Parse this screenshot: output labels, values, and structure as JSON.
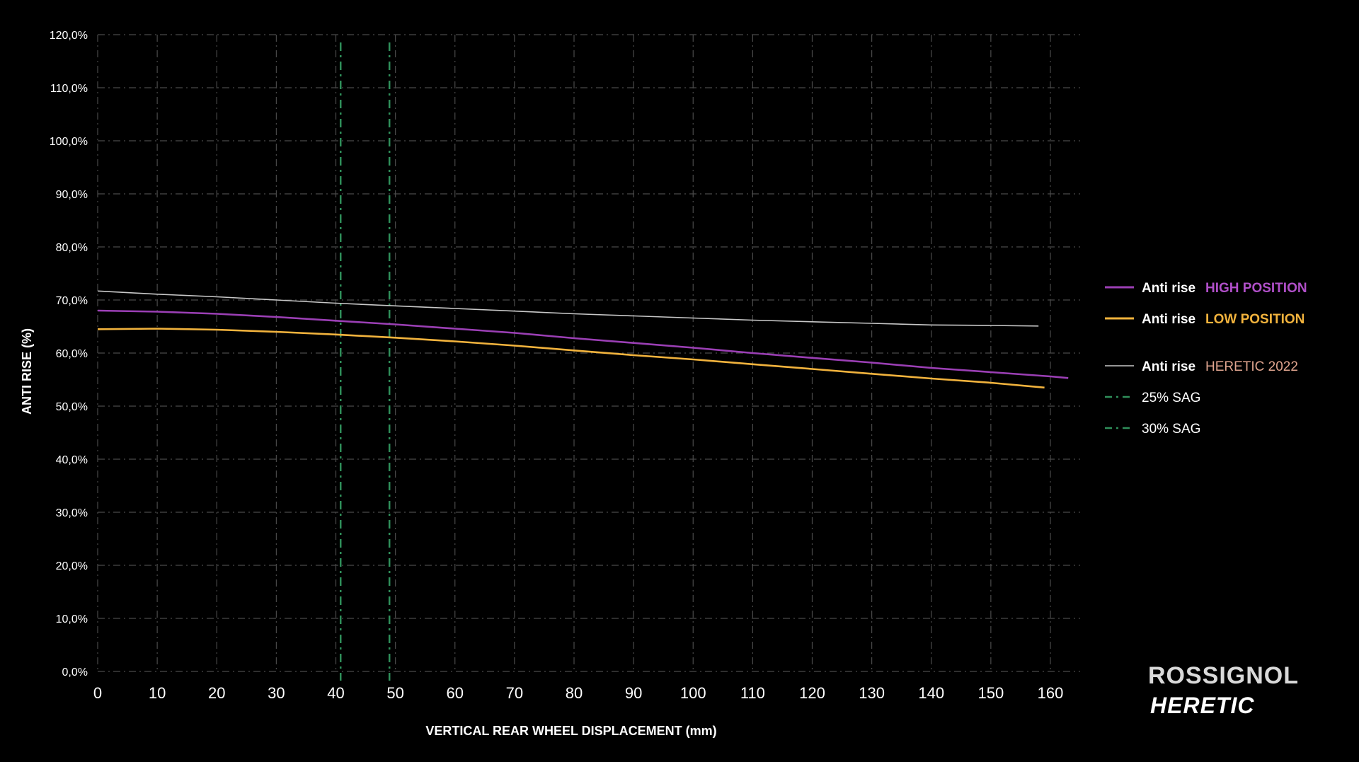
{
  "chart_data": {
    "type": "line",
    "xlabel": "VERTICAL REAR WHEEL DISPLACEMENT (mm)",
    "ylabel": "ANTI RISE (%)",
    "xlim": [
      0,
      165
    ],
    "ylim": [
      0,
      120
    ],
    "x_ticks": [
      "0",
      "10",
      "20",
      "30",
      "40",
      "50",
      "60",
      "70",
      "80",
      "90",
      "100",
      "110",
      "120",
      "130",
      "140",
      "150",
      "160"
    ],
    "y_ticks": [
      "0,0%",
      "10,0%",
      "20,0%",
      "30,0%",
      "40,0%",
      "50,0%",
      "60,0%",
      "70,0%",
      "80,0%",
      "90,0%",
      "100,0%",
      "110,0%",
      "120,0%"
    ],
    "grid": true,
    "legend_position": "right",
    "series": [
      {
        "key": "high",
        "label_bold": "Anti rise",
        "label_tag": "HIGH POSITION",
        "color": "#9b3fb5",
        "tag_color": "#b04fc8",
        "style": "solid",
        "points": [
          [
            0,
            68.0
          ],
          [
            10,
            67.8
          ],
          [
            20,
            67.4
          ],
          [
            30,
            66.8
          ],
          [
            40,
            66.1
          ],
          [
            50,
            65.4
          ],
          [
            60,
            64.6
          ],
          [
            70,
            63.8
          ],
          [
            80,
            62.8
          ],
          [
            90,
            61.9
          ],
          [
            100,
            61.0
          ],
          [
            110,
            60.0
          ],
          [
            120,
            59.1
          ],
          [
            130,
            58.2
          ],
          [
            140,
            57.2
          ],
          [
            150,
            56.4
          ],
          [
            160,
            55.6
          ],
          [
            163,
            55.3
          ]
        ]
      },
      {
        "key": "low",
        "label_bold": "Anti rise",
        "label_tag": "LOW POSITION",
        "color": "#f2b33d",
        "tag_color": "#f2b33d",
        "style": "solid",
        "points": [
          [
            0,
            64.5
          ],
          [
            10,
            64.6
          ],
          [
            20,
            64.4
          ],
          [
            30,
            64.0
          ],
          [
            40,
            63.5
          ],
          [
            50,
            62.9
          ],
          [
            60,
            62.2
          ],
          [
            70,
            61.4
          ],
          [
            80,
            60.5
          ],
          [
            90,
            59.6
          ],
          [
            100,
            58.8
          ],
          [
            110,
            57.9
          ],
          [
            120,
            57.0
          ],
          [
            130,
            56.1
          ],
          [
            140,
            55.2
          ],
          [
            150,
            54.4
          ],
          [
            159,
            53.5
          ]
        ]
      },
      {
        "key": "heretic2022",
        "label_bold": "Anti rise",
        "label_tag": "HERETIC 2022",
        "color": "#c8c8c8",
        "tag_color": "#e0a58f",
        "style": "solid",
        "points": [
          [
            0,
            71.7
          ],
          [
            10,
            71.1
          ],
          [
            20,
            70.6
          ],
          [
            30,
            70.0
          ],
          [
            40,
            69.4
          ],
          [
            50,
            68.9
          ],
          [
            60,
            68.4
          ],
          [
            70,
            67.9
          ],
          [
            80,
            67.4
          ],
          [
            90,
            67.0
          ],
          [
            100,
            66.6
          ],
          [
            110,
            66.2
          ],
          [
            120,
            65.9
          ],
          [
            130,
            65.6
          ],
          [
            140,
            65.3
          ],
          [
            150,
            65.2
          ],
          [
            158,
            65.1
          ]
        ]
      }
    ],
    "sag_lines": [
      {
        "key": "sag25",
        "label": "25% SAG",
        "x": 40.8,
        "color": "#2f8f5a"
      },
      {
        "key": "sag30",
        "label": "30% SAG",
        "x": 49.0,
        "color": "#2f8f5a"
      }
    ]
  },
  "brand": {
    "name": "ROSSIGNOL",
    "model": "HERETIC"
  }
}
